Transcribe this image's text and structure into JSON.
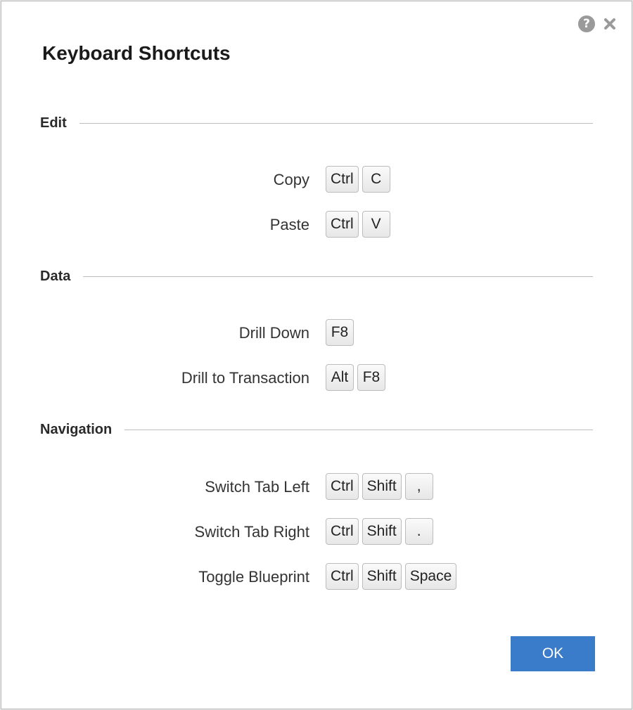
{
  "dialog": {
    "title": "Keyboard Shortcuts",
    "help_icon": "?",
    "ok_label": "OK"
  },
  "sections": {
    "edit": {
      "label": "Edit",
      "rows": [
        {
          "action": "Copy",
          "keys": [
            "Ctrl",
            "C"
          ]
        },
        {
          "action": "Paste",
          "keys": [
            "Ctrl",
            "V"
          ]
        }
      ]
    },
    "data": {
      "label": "Data",
      "rows": [
        {
          "action": "Drill Down",
          "keys": [
            "F8"
          ]
        },
        {
          "action": "Drill to Transaction",
          "keys": [
            "Alt",
            "F8"
          ]
        }
      ]
    },
    "navigation": {
      "label": "Navigation",
      "rows": [
        {
          "action": "Switch Tab Left",
          "keys": [
            "Ctrl",
            "Shift",
            ","
          ]
        },
        {
          "action": "Switch Tab Right",
          "keys": [
            "Ctrl",
            "Shift",
            "."
          ]
        },
        {
          "action": "Toggle Blueprint",
          "keys": [
            "Ctrl",
            "Shift",
            "Space"
          ]
        }
      ]
    }
  },
  "colors": {
    "accent": "#3a7cc9",
    "divider": "#bdbdbd",
    "key_border": "#bcbcbc"
  }
}
